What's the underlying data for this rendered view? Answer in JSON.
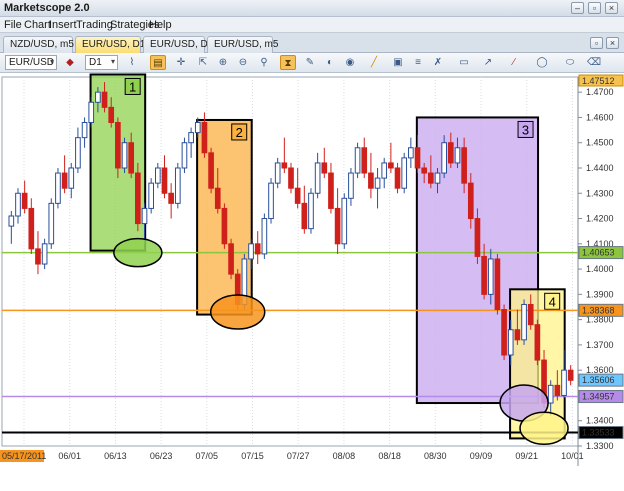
{
  "window": {
    "title": "Marketscope 2.0",
    "controls": [
      "–",
      "▫",
      "×"
    ]
  },
  "menu": [
    "File",
    "Chart",
    "Insert",
    "Trading",
    "Strategies",
    "Help"
  ],
  "tabs": [
    {
      "label": "NZD/USD, m5",
      "active": false
    },
    {
      "label": "EUR/USD, D1",
      "active": true,
      "close": "×"
    },
    {
      "label": "EUR/USD, D1",
      "active": false
    },
    {
      "label": "EUR/USD, m5",
      "active": false
    }
  ],
  "toolbar": {
    "symbol": "EUR/USD",
    "period": "D1",
    "tools": [
      "line-chart-icon",
      "bar-chart-icon",
      "crosshair-icon",
      "pointer-icon",
      "zoom-in-icon",
      "zoom-out-icon",
      "zoom-fit-icon",
      "magnifier-icon",
      "hourglass-icon",
      "edit-icon",
      "palette-icon",
      "globe-icon",
      "ruler-icon",
      "image-icon",
      "fibonacci-icon",
      "tools-icon",
      "window-icon",
      "arrow-icon",
      "pen-icon",
      "shapes-icon",
      "ellipse-icon",
      "eraser-icon"
    ]
  },
  "chart_data": {
    "type": "candlestick",
    "ylim": [
      1.33,
      1.476
    ],
    "y_ticks": [
      "1.4700",
      "1.4600",
      "1.4500",
      "1.4400",
      "1.4300",
      "1.4200",
      "1.4100",
      "1.4000",
      "1.3900",
      "1.3800",
      "1.3700",
      "1.3600",
      "1.3500",
      "1.3400",
      "1.3300"
    ],
    "x_ticks": [
      "05/17/2011",
      "06/01",
      "06/13",
      "06/23",
      "07/05",
      "07/15",
      "07/27",
      "08/08",
      "08/18",
      "08/30",
      "09/09",
      "09/21",
      "10/01"
    ],
    "current_price_label": "1.47512",
    "levels": [
      {
        "value": 1.40653,
        "label": "1.40653",
        "color": "#8cc63f"
      },
      {
        "value": 1.38368,
        "label": "1.38368",
        "color": "#f7941d"
      },
      {
        "value": 1.35606,
        "label": "1.35606",
        "color": "#6ec6ff",
        "marker": true
      },
      {
        "value": 1.34957,
        "label": "1.34957",
        "color": "#b48be8"
      },
      {
        "value": 1.33533,
        "label": "1.33533",
        "color": "#000000"
      }
    ],
    "zones": [
      {
        "label": "1",
        "color": "#8fd14f"
      },
      {
        "label": "2",
        "color": "#fbb040"
      },
      {
        "label": "3",
        "color": "#c7a7f0"
      },
      {
        "label": "4",
        "color": "#fff38a"
      }
    ],
    "candles": [
      [
        1.417,
        1.423,
        1.41,
        1.421
      ],
      [
        1.421,
        1.432,
        1.418,
        1.43
      ],
      [
        1.43,
        1.435,
        1.422,
        1.424
      ],
      [
        1.424,
        1.428,
        1.406,
        1.408
      ],
      [
        1.408,
        1.415,
        1.398,
        1.402
      ],
      [
        1.402,
        1.412,
        1.4,
        1.41
      ],
      [
        1.41,
        1.428,
        1.408,
        1.426
      ],
      [
        1.426,
        1.44,
        1.424,
        1.438
      ],
      [
        1.438,
        1.445,
        1.43,
        1.432
      ],
      [
        1.432,
        1.442,
        1.428,
        1.44
      ],
      [
        1.44,
        1.456,
        1.438,
        1.452
      ],
      [
        1.452,
        1.46,
        1.448,
        1.458
      ],
      [
        1.458,
        1.468,
        1.456,
        1.466
      ],
      [
        1.466,
        1.472,
        1.462,
        1.47
      ],
      [
        1.47,
        1.474,
        1.462,
        1.464
      ],
      [
        1.464,
        1.468,
        1.456,
        1.458
      ],
      [
        1.458,
        1.46,
        1.436,
        1.44
      ],
      [
        1.44,
        1.452,
        1.438,
        1.45
      ],
      [
        1.45,
        1.454,
        1.436,
        1.438
      ],
      [
        1.438,
        1.442,
        1.415,
        1.418
      ],
      [
        1.418,
        1.426,
        1.41,
        1.424
      ],
      [
        1.424,
        1.436,
        1.422,
        1.434
      ],
      [
        1.434,
        1.442,
        1.432,
        1.44
      ],
      [
        1.44,
        1.445,
        1.428,
        1.43
      ],
      [
        1.43,
        1.434,
        1.42,
        1.426
      ],
      [
        1.426,
        1.442,
        1.424,
        1.44
      ],
      [
        1.44,
        1.452,
        1.438,
        1.45
      ],
      [
        1.45,
        1.456,
        1.444,
        1.454
      ],
      [
        1.454,
        1.46,
        1.452,
        1.458
      ],
      [
        1.458,
        1.462,
        1.444,
        1.446
      ],
      [
        1.446,
        1.448,
        1.43,
        1.432
      ],
      [
        1.432,
        1.44,
        1.422,
        1.424
      ],
      [
        1.424,
        1.426,
        1.408,
        1.41
      ],
      [
        1.41,
        1.412,
        1.396,
        1.398
      ],
      [
        1.398,
        1.4,
        1.384,
        1.386
      ],
      [
        1.386,
        1.406,
        1.384,
        1.404
      ],
      [
        1.404,
        1.412,
        1.4,
        1.41
      ],
      [
        1.41,
        1.415,
        1.402,
        1.406
      ],
      [
        1.406,
        1.422,
        1.404,
        1.42
      ],
      [
        1.42,
        1.436,
        1.418,
        1.434
      ],
      [
        1.434,
        1.444,
        1.432,
        1.442
      ],
      [
        1.442,
        1.452,
        1.438,
        1.44
      ],
      [
        1.44,
        1.442,
        1.43,
        1.432
      ],
      [
        1.432,
        1.44,
        1.424,
        1.426
      ],
      [
        1.426,
        1.433,
        1.414,
        1.416
      ],
      [
        1.416,
        1.432,
        1.414,
        1.43
      ],
      [
        1.43,
        1.446,
        1.428,
        1.442
      ],
      [
        1.442,
        1.448,
        1.436,
        1.438
      ],
      [
        1.438,
        1.442,
        1.422,
        1.424
      ],
      [
        1.424,
        1.432,
        1.406,
        1.41
      ],
      [
        1.41,
        1.43,
        1.408,
        1.428
      ],
      [
        1.428,
        1.44,
        1.425,
        1.438
      ],
      [
        1.438,
        1.45,
        1.436,
        1.448
      ],
      [
        1.448,
        1.452,
        1.436,
        1.438
      ],
      [
        1.438,
        1.446,
        1.428,
        1.432
      ],
      [
        1.432,
        1.44,
        1.424,
        1.436
      ],
      [
        1.436,
        1.444,
        1.432,
        1.442
      ],
      [
        1.442,
        1.45,
        1.438,
        1.44
      ],
      [
        1.44,
        1.442,
        1.43,
        1.432
      ],
      [
        1.432,
        1.446,
        1.43,
        1.444
      ],
      [
        1.444,
        1.452,
        1.44,
        1.448
      ],
      [
        1.448,
        1.453,
        1.438,
        1.44
      ],
      [
        1.44,
        1.442,
        1.434,
        1.438
      ],
      [
        1.438,
        1.445,
        1.432,
        1.434
      ],
      [
        1.434,
        1.44,
        1.43,
        1.438
      ],
      [
        1.438,
        1.453,
        1.436,
        1.45
      ],
      [
        1.45,
        1.454,
        1.44,
        1.442
      ],
      [
        1.442,
        1.452,
        1.44,
        1.448
      ],
      [
        1.448,
        1.452,
        1.43,
        1.434
      ],
      [
        1.434,
        1.438,
        1.416,
        1.42
      ],
      [
        1.42,
        1.424,
        1.402,
        1.405
      ],
      [
        1.405,
        1.41,
        1.388,
        1.39
      ],
      [
        1.39,
        1.408,
        1.386,
        1.404
      ],
      [
        1.404,
        1.406,
        1.382,
        1.384
      ],
      [
        1.384,
        1.386,
        1.364,
        1.366
      ],
      [
        1.366,
        1.38,
        1.362,
        1.376
      ],
      [
        1.376,
        1.384,
        1.37,
        1.372
      ],
      [
        1.372,
        1.388,
        1.37,
        1.386
      ],
      [
        1.386,
        1.39,
        1.376,
        1.378
      ],
      [
        1.378,
        1.38,
        1.362,
        1.364
      ],
      [
        1.364,
        1.368,
        1.345,
        1.347
      ],
      [
        1.347,
        1.356,
        1.342,
        1.354
      ],
      [
        1.354,
        1.36,
        1.348,
        1.35
      ],
      [
        1.35,
        1.368,
        1.349,
        1.36
      ],
      [
        1.36,
        1.362,
        1.354,
        1.356
      ]
    ]
  }
}
